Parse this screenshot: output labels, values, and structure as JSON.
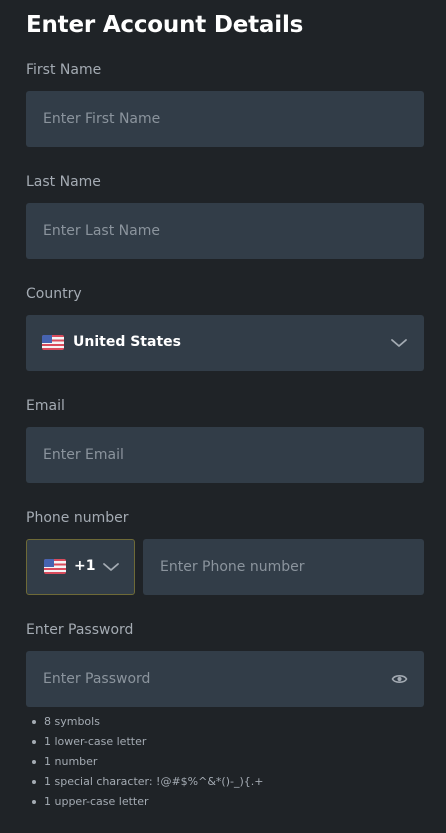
{
  "form": {
    "title": "Enter Account Details",
    "first_name": {
      "label": "First Name",
      "placeholder": "Enter First Name"
    },
    "last_name": {
      "label": "Last Name",
      "placeholder": "Enter Last Name"
    },
    "country": {
      "label": "Country",
      "value": "United States",
      "flag_icon": "us-flag-icon"
    },
    "email": {
      "label": "Email",
      "placeholder": "Enter Email"
    },
    "phone": {
      "label": "Phone number",
      "country_code": "+1",
      "placeholder": "Enter Phone number"
    },
    "password": {
      "label": "Enter Password",
      "placeholder": "Enter Password",
      "toggle_icon": "eye-icon",
      "requirements": [
        "8 symbols",
        "1 lower-case letter",
        "1 number",
        "1 special character: !@#$%^&*()-_){.+",
        "1 upper-case letter"
      ]
    }
  },
  "colors": {
    "background": "#1f2327",
    "field": "#323d48",
    "label": "#a4abb3",
    "placeholder": "#8b949d",
    "focus_border": "#6e6a37"
  }
}
